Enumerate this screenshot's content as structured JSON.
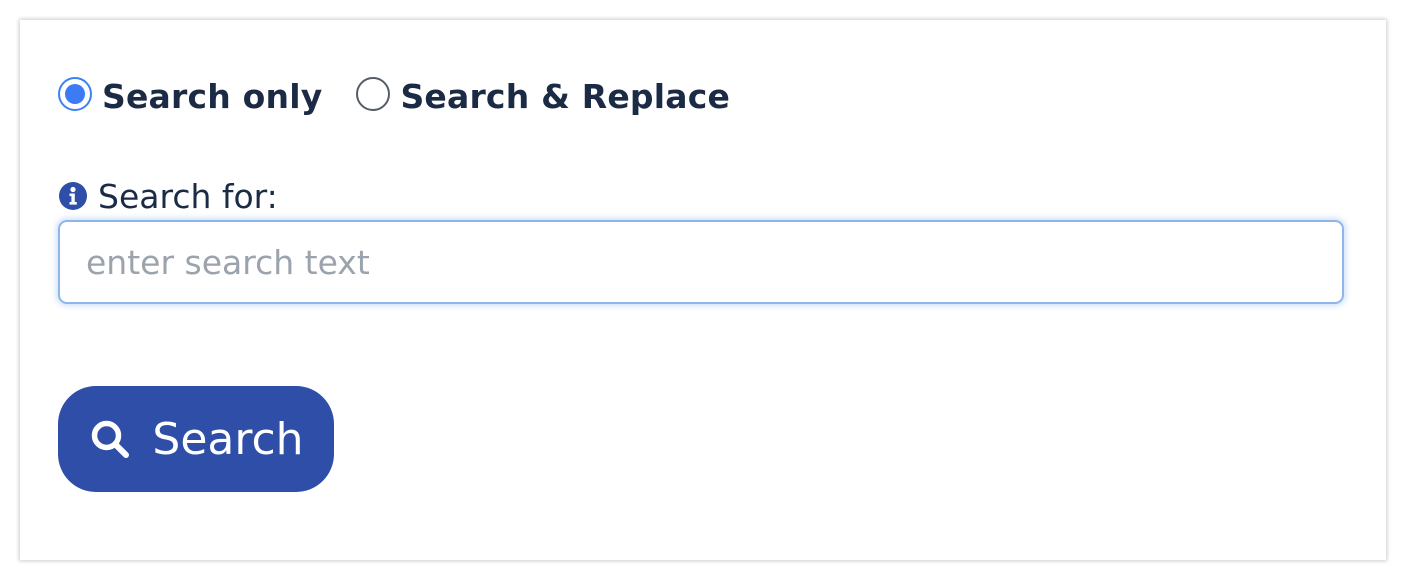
{
  "mode": {
    "options": [
      {
        "label": "Search only",
        "selected": true
      },
      {
        "label": "Search & Replace",
        "selected": false
      }
    ]
  },
  "search_field": {
    "label": "Search for:",
    "placeholder": "enter search text",
    "value": "",
    "icon": "info-icon"
  },
  "search_button": {
    "label": "Search",
    "icon": "magnifier-icon"
  },
  "colors": {
    "accent": "#3b7cf5",
    "button": "#2e4ea8",
    "text": "#1c2b45",
    "placeholder": "#9ba3ad",
    "input_focus_border": "#8fb6ea"
  }
}
